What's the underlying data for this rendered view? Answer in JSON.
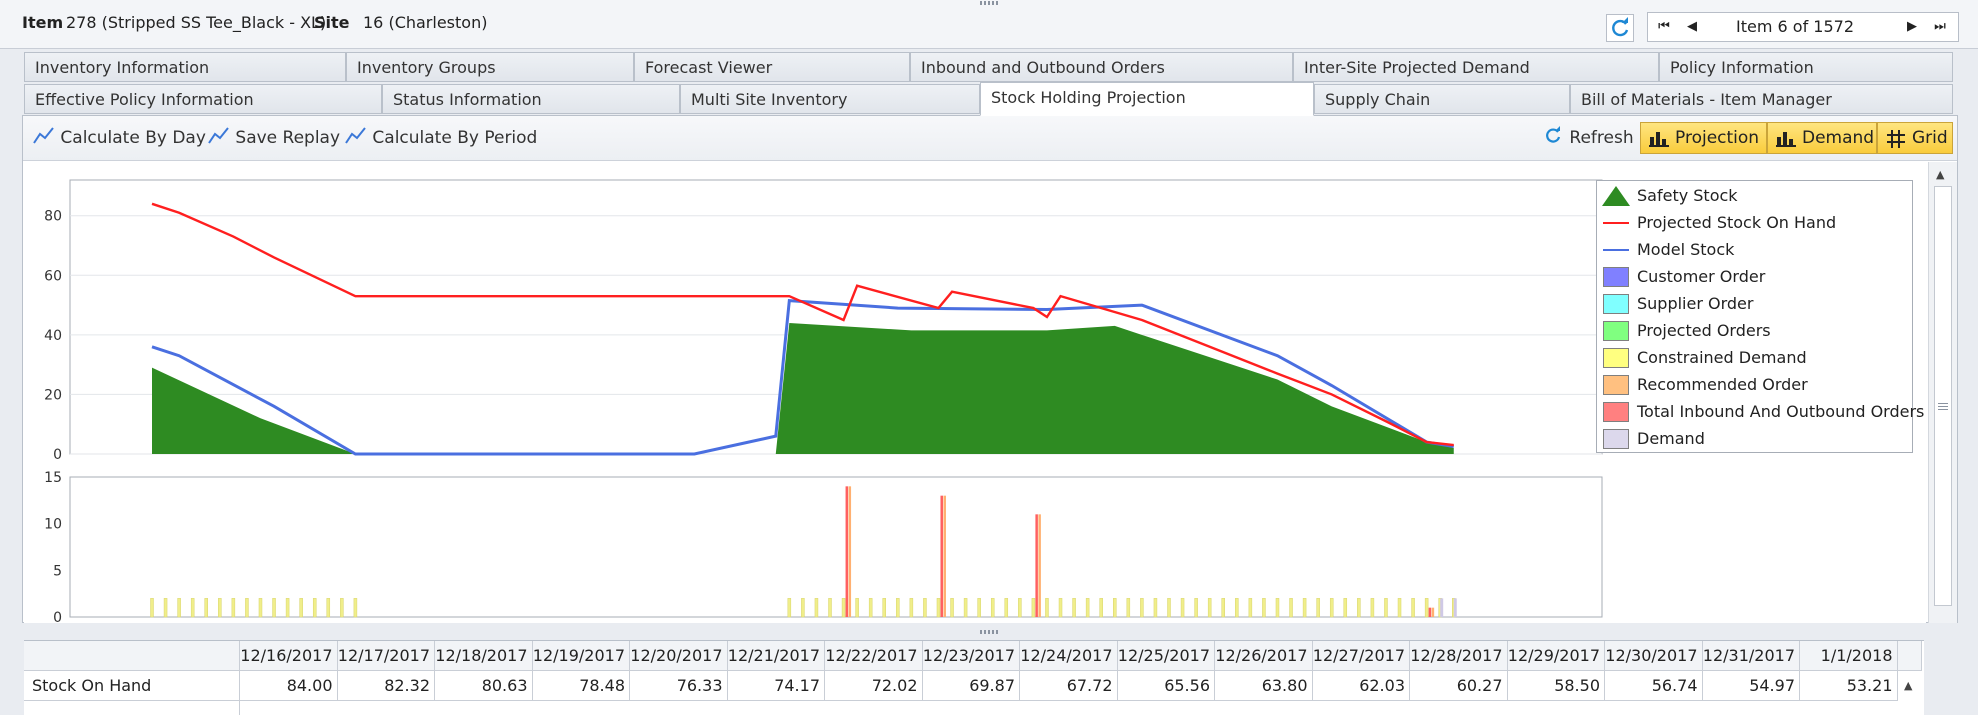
{
  "header": {
    "item_label": "Item",
    "item_value": "278 (Stripped SS Tee_Black - XL)",
    "site_label": "Site",
    "site_value": "16 (Charleston)",
    "nav_text": "Item 6 of 1572"
  },
  "tabs_row1": [
    "Inventory Information",
    "Inventory Groups",
    "Forecast Viewer",
    "Inbound and Outbound Orders",
    "Inter-Site Projected Demand",
    "Policy Information"
  ],
  "tabs_row2": [
    "Effective Policy Information",
    "Status Information",
    "Multi Site Inventory",
    "Stock Holding Projection",
    "Supply Chain",
    "Bill of Materials - Item Manager"
  ],
  "active_tab": "Stock Holding Projection",
  "toolbar": {
    "calc_day": "Calculate By Day",
    "save_replay": "Save Replay",
    "calc_period": "Calculate By Period",
    "refresh": "Refresh",
    "projection": "Projection",
    "demand": "Demand",
    "grid": "Grid"
  },
  "legend": [
    {
      "label": "Safety Stock",
      "color": "#2e8b22",
      "kind": "triangle"
    },
    {
      "label": "Projected Stock On Hand",
      "color": "#ff1f1f",
      "kind": "line"
    },
    {
      "label": "Model Stock",
      "color": "#4a6fe0",
      "kind": "line"
    },
    {
      "label": "Customer Order",
      "color": "#8080ff",
      "kind": "box"
    },
    {
      "label": "Supplier Order",
      "color": "#80ffff",
      "kind": "box"
    },
    {
      "label": "Projected Orders",
      "color": "#80ff80",
      "kind": "box"
    },
    {
      "label": "Constrained Demand",
      "color": "#ffff80",
      "kind": "box"
    },
    {
      "label": "Recommended Order",
      "color": "#ffc080",
      "kind": "box"
    },
    {
      "label": "Total Inbound And Outbound Orders",
      "color": "#ff8080",
      "kind": "box"
    },
    {
      "label": "Demand",
      "color": "#dcd8ec",
      "kind": "box"
    }
  ],
  "chart_data": [
    {
      "type": "area",
      "ylim": [
        0,
        92
      ],
      "yticks": [
        "0",
        "20",
        "40",
        "60",
        "80"
      ],
      "n": 100,
      "series": [
        {
          "name": "Projected Stock On Hand",
          "values": [
            [
              0,
              84
            ],
            [
              2,
              81
            ],
            [
              6,
              73
            ],
            [
              9,
              66
            ],
            [
              15,
              53
            ],
            [
              23,
              53
            ],
            [
              43,
              53
            ],
            [
              47,
              53
            ],
            [
              51,
              45
            ],
            [
              52,
              56.5
            ],
            [
              58,
              49
            ],
            [
              59,
              54.5
            ],
            [
              65,
              49
            ],
            [
              66,
              46
            ],
            [
              67,
              53
            ],
            [
              73,
              45
            ],
            [
              78,
              36
            ],
            [
              83,
              27
            ],
            [
              87,
              20
            ],
            [
              91,
              11
            ],
            [
              94,
              4
            ],
            [
              96,
              3
            ]
          ]
        },
        {
          "name": "Model Stock",
          "values": [
            [
              0,
              36
            ],
            [
              2,
              33
            ],
            [
              9,
              16
            ],
            [
              15,
              0
            ],
            [
              40,
              0
            ],
            [
              46,
              6
            ],
            [
              47,
              51.5
            ],
            [
              55,
              49
            ],
            [
              66,
              48.5
            ],
            [
              73,
              50
            ],
            [
              83,
              33
            ],
            [
              87,
              23
            ],
            [
              94,
              4
            ],
            [
              96,
              2.5
            ]
          ]
        },
        {
          "name": "Safety Stock",
          "values": [
            [
              0,
              29
            ],
            [
              8,
              12
            ],
            [
              15,
              0
            ],
            [
              46,
              0
            ],
            [
              47,
              44
            ],
            [
              56,
              41.5
            ],
            [
              66,
              41.5
            ],
            [
              71,
              43
            ],
            [
              83,
              25
            ],
            [
              87,
              16
            ],
            [
              94,
              4
            ],
            [
              96,
              2
            ]
          ]
        }
      ]
    },
    {
      "type": "bar",
      "ylim": [
        0,
        15
      ],
      "yticks": [
        "0",
        "5",
        "10",
        "15"
      ],
      "n": 100,
      "series": [
        {
          "name": "Constrained Demand",
          "values": [
            2,
            2,
            2,
            2,
            2,
            2,
            2,
            2,
            2,
            2,
            2,
            2,
            2,
            2,
            2,
            2,
            0,
            0,
            0,
            0,
            0,
            0,
            0,
            0,
            0,
            0,
            0,
            0,
            0,
            0,
            0,
            0,
            0,
            0,
            0,
            0,
            0,
            0,
            0,
            0,
            0,
            0,
            0,
            0,
            0,
            0,
            0,
            2,
            2,
            2,
            2,
            2,
            2,
            2,
            2,
            2,
            2,
            2,
            2,
            2,
            2,
            2,
            2,
            2,
            2,
            2,
            2,
            2,
            2,
            2,
            2,
            2,
            2,
            2,
            2,
            2,
            2,
            2,
            2,
            2,
            2,
            2,
            2,
            2,
            2,
            2,
            2,
            2,
            2,
            2,
            2,
            2,
            2,
            2,
            2,
            2,
            2,
            0,
            0,
            0
          ]
        },
        {
          "name": "Total Inbound And Outbound Orders",
          "values": [
            [
              51,
              14
            ],
            [
              58,
              13
            ],
            [
              65,
              11
            ],
            [
              94,
              1
            ]
          ]
        },
        {
          "name": "Demand",
          "values": [
            [
              95,
              2
            ],
            [
              96,
              2
            ]
          ]
        }
      ]
    }
  ],
  "grid": {
    "dates": [
      "12/16/2017",
      "12/17/2017",
      "12/18/2017",
      "12/19/2017",
      "12/20/2017",
      "12/21/2017",
      "12/22/2017",
      "12/23/2017",
      "12/24/2017",
      "12/25/2017",
      "12/26/2017",
      "12/27/2017",
      "12/28/2017",
      "12/29/2017",
      "12/30/2017",
      "12/31/2017",
      "1/1/2018"
    ],
    "rows": [
      {
        "label": "Stock On Hand",
        "values": [
          "84.00",
          "82.32",
          "80.63",
          "78.48",
          "76.33",
          "74.17",
          "72.02",
          "69.87",
          "67.72",
          "65.56",
          "63.80",
          "62.03",
          "60.27",
          "58.50",
          "56.74",
          "54.97",
          "53.21"
        ]
      }
    ]
  }
}
